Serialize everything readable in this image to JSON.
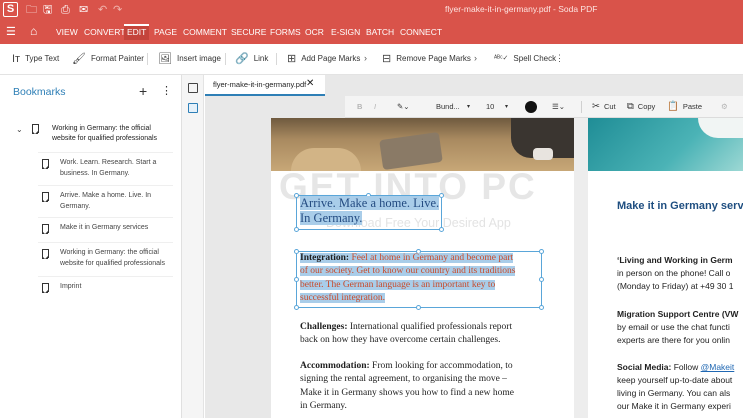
{
  "titlebar": {
    "title": "flyer-make-it-in-germany.pdf - Soda PDF",
    "logo": "S",
    "icons": [
      "folder-icon",
      "save-icon",
      "print-icon",
      "mail-icon",
      "undo-icon",
      "redo-icon"
    ]
  },
  "menu": {
    "tabs": [
      "VIEW",
      "CONVERT",
      "EDIT",
      "PAGE",
      "COMMENT",
      "SECURE",
      "FORMS",
      "OCR",
      "E-SIGN",
      "BATCH",
      "CONNECT"
    ],
    "active": "EDIT"
  },
  "toolbar": {
    "type_text": "Type Text",
    "format_painter": "Format Painter",
    "insert_image": "Insert image",
    "link": "Link",
    "add_page_marks": "Add Page Marks",
    "remove_page_marks": "Remove Page Marks",
    "spell_check": "Spell Check"
  },
  "bookmarks": {
    "title": "Bookmarks",
    "parent": "Working in Germany: the official website for qualified professionals",
    "children": [
      "Work. Learn. Research. Start a business. In Germany.",
      "Arrive. Make a home. Live. In Germany.",
      "Make it in Germany services",
      "Working in Germany: the official website for qualified professionals",
      "Imprint"
    ]
  },
  "document": {
    "tab_name": "flyer-make-it-in-germany.pdf",
    "format": {
      "font": "Bund...",
      "size": "10",
      "cut": "Cut",
      "copy": "Copy",
      "paste": "Paste",
      "text_color": "#111111"
    },
    "watermark": "GET INTO PC",
    "watermark_sub": "Download Free Your Desired App",
    "page1": {
      "heading_line1": "Arrive. Make a home. Live.",
      "heading_line2": "In Germany.",
      "integration_label": "Integration:",
      "integration_lines": [
        " Feel at home in Germany and become part",
        "of our society. Get to know our country and its traditions",
        "better. The German language is an important key to",
        "successful integration."
      ],
      "challenges_label": "Challenges:",
      "challenges_lines": [
        " International qualified professionals report",
        "back on how they have overcome certain challenges."
      ],
      "accommodation_label": "Accommodation:",
      "accommodation_lines": [
        " From looking for accommodation, to",
        "signing the rental agreement, to organising the move –",
        "Make it in Germany shows you how to find a new home",
        "in Germany."
      ]
    },
    "page2": {
      "title": "Make it in Germany servi",
      "lines": [
        "‘Living and Working in Germ",
        "in person on the phone! Call o",
        "(Monday to Friday) at +49 30 1"
      ],
      "migration_lines": [
        "Migration Support Centre (VW",
        "by email or use the chat functi",
        "experts are there for you onlin"
      ],
      "social_label": "Social Media:",
      "social_follow": " Follow ",
      "social_handle": "@Makeit",
      "social_lines": [
        "keep yourself up-to-date about",
        "living in Germany. You can als",
        "our Make it in Germany experi"
      ]
    }
  },
  "colors": {
    "brand": "#d9534a",
    "accent": "#2e7fb6",
    "selection": "#a9cde9"
  }
}
